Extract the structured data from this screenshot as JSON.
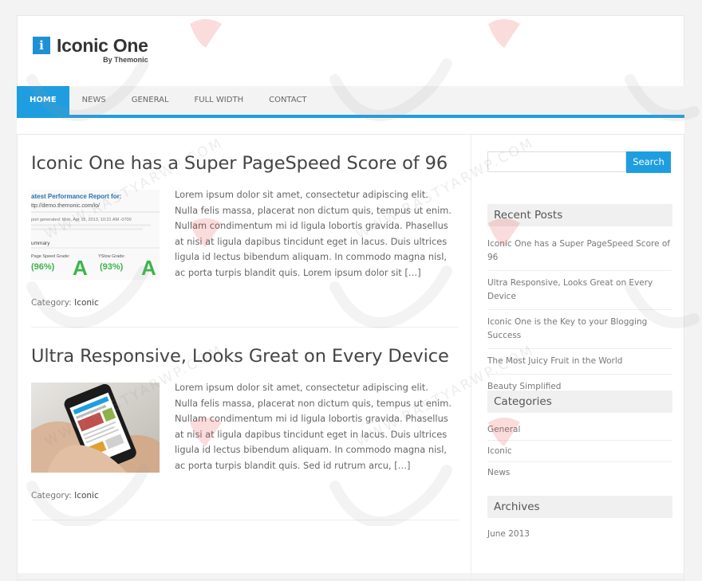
{
  "header": {
    "logo_letter": "i",
    "site_title": "Iconic One",
    "byline": "By Themonic"
  },
  "nav": {
    "items": [
      "Home",
      "News",
      "General",
      "Full Width",
      "Contact"
    ]
  },
  "posts": [
    {
      "title": "Iconic One has a Super PageSpeed Score of 96",
      "excerpt": "Lorem ipsum dolor sit amet, consectetur adipiscing elit. Nulla felis massa, placerat non dictum quis, tempus ut enim. Nullam condimentum mi id ligula lobortis gravida. Phasellus at nisi at ligula dapibus tincidunt eget in lacus. Duis ultrices ligula id lectus bibendum aliquam. In commodo magna nisl, ac porta turpis blandit quis. Lorem ipsum dolor sit […]",
      "category_label": "Category:",
      "category": "Iconic",
      "thumb": {
        "heading": "atest Performance Report for:",
        "url": "ttp://demo.themonic.com/io/",
        "generated": "port generated: Mon, Apr 15, 2013, 10:21 AM -0700",
        "summary": "ummary",
        "page_speed_label": "Page Speed Grade:",
        "page_speed_value": "(96%)",
        "yslow_label": "YSlow Grade:",
        "yslow_value": "(93%)",
        "grade": "A"
      }
    },
    {
      "title": "Ultra Responsive, Looks Great on Every Device",
      "excerpt": "Lorem ipsum dolor sit amet, consectetur adipiscing elit. Nulla felis massa, placerat non dictum quis, tempus ut enim. Nullam condimentum mi id ligula lobortis gravida. Phasellus at nisi at ligula dapibus tincidunt eget in lacus. Duis ultrices ligula id lectus bibendum aliquam. In commodo magna nisl, ac porta turpis blandit quis. Sed id rutrum arcu, […]",
      "category_label": "Category:",
      "category": "Iconic"
    }
  ],
  "sidebar": {
    "search_button": "Search",
    "recent_posts_title": "Recent Posts",
    "recent_posts": [
      "Iconic One has a Super PageSpeed Score of 96",
      "Ultra Responsive, Looks Great on Every Device",
      "Iconic One is the Key to your Blogging Success",
      "The Most Juicy Fruit in the World",
      "Beauty Simplified"
    ],
    "categories_title": "Categories",
    "categories": [
      "General",
      "Iconic",
      "News"
    ],
    "archives_title": "Archives",
    "archives": [
      "June 2013"
    ]
  },
  "watermark_text": "WWW.RASTYARWP.COM",
  "colors": {
    "accent": "#1e9ee0",
    "logo_blue": "#1e90d6",
    "grade_green": "#3cb54a"
  }
}
